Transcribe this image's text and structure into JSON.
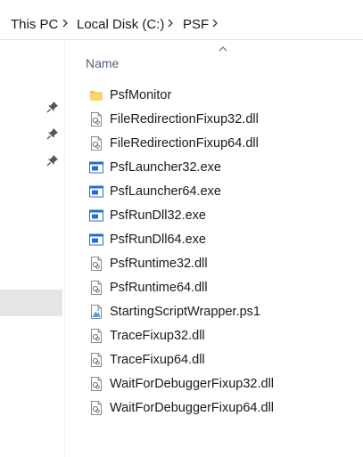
{
  "breadcrumb": [
    "This PC",
    "Local Disk (C:)",
    "PSF"
  ],
  "column_header": "Name",
  "files": [
    {
      "name": "PsfMonitor",
      "type": "folder",
      "icon": "folder-icon"
    },
    {
      "name": "FileRedirectionFixup32.dll",
      "type": "dll",
      "icon": "dll-file-icon"
    },
    {
      "name": "FileRedirectionFixup64.dll",
      "type": "dll",
      "icon": "dll-file-icon"
    },
    {
      "name": "PsfLauncher32.exe",
      "type": "exe",
      "icon": "exe-file-icon"
    },
    {
      "name": "PsfLauncher64.exe",
      "type": "exe",
      "icon": "exe-file-icon"
    },
    {
      "name": "PsfRunDll32.exe",
      "type": "exe",
      "icon": "exe-file-icon"
    },
    {
      "name": "PsfRunDll64.exe",
      "type": "exe",
      "icon": "exe-file-icon"
    },
    {
      "name": "PsfRuntime32.dll",
      "type": "dll",
      "icon": "dll-file-icon"
    },
    {
      "name": "PsfRuntime64.dll",
      "type": "dll",
      "icon": "dll-file-icon"
    },
    {
      "name": "StartingScriptWrapper.ps1",
      "type": "ps1",
      "icon": "powershell-script-icon"
    },
    {
      "name": "TraceFixup32.dll",
      "type": "dll",
      "icon": "dll-file-icon"
    },
    {
      "name": "TraceFixup64.dll",
      "type": "dll",
      "icon": "dll-file-icon"
    },
    {
      "name": "WaitForDebuggerFixup32.dll",
      "type": "dll",
      "icon": "dll-file-icon"
    },
    {
      "name": "WaitForDebuggerFixup64.dll",
      "type": "dll",
      "icon": "dll-file-icon"
    }
  ],
  "colors": {
    "folder": "#f8c642",
    "exe_accent": "#1e6fd9",
    "header_text": "#4c607a"
  }
}
